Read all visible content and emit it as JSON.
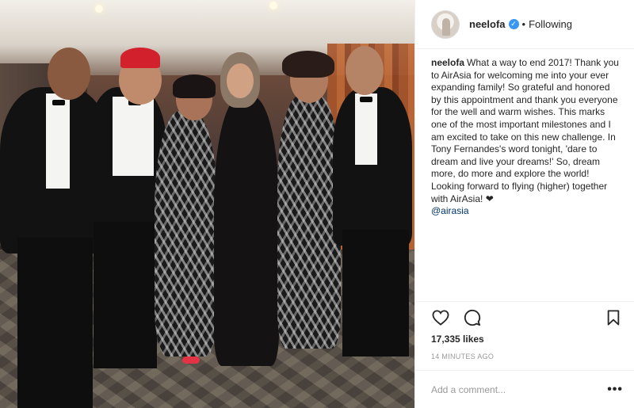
{
  "header": {
    "username": "neelofa",
    "verified_icon": "verified-badge-icon",
    "separator": "•",
    "follow_state": "Following"
  },
  "caption": {
    "username": "neelofa",
    "text": "What a way to end 2017! Thank you to AirAsia for welcoming me into your ever expanding family! So grateful and honored by this appointment and thank you everyone for the well and warm wishes. This marks one of the most important milestones and I am excited to take on this new challenge. In Tony Fernandes's word tonight, 'dare to dream and live your dreams!' So, dream more, do more and explore the world! Looking forward to flying (higher) together with AirAsia! ❤",
    "mention": "@airasia"
  },
  "actions": {
    "like_icon": "heart-icon",
    "comment_icon": "comment-icon",
    "save_icon": "bookmark-icon"
  },
  "likes": "17,335 likes",
  "timestamp": "14 MINUTES AGO",
  "comment": {
    "placeholder": "Add a comment...",
    "more_label": "•••"
  },
  "colors": {
    "link": "#003569",
    "verified": "#3897f0",
    "muted": "#999999",
    "border": "#efefef"
  }
}
